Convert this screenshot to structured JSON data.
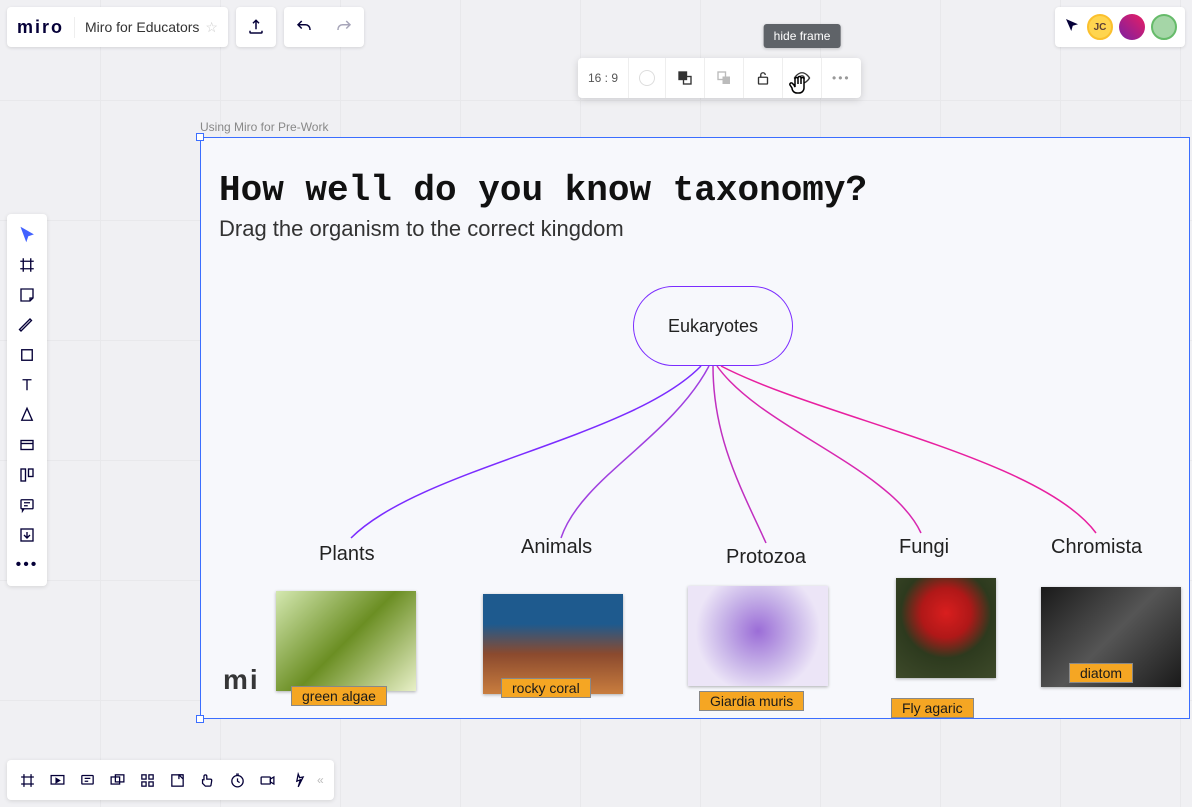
{
  "app": {
    "logo": "miro",
    "board_title": "Miro for Educators"
  },
  "ctx": {
    "ratio": "16 : 9",
    "tooltip": "hide frame"
  },
  "frame": {
    "label": "Using Miro for Pre-Work",
    "title": "How well do you know taxonomy?",
    "subtitle": "Drag the organism to the correct kingdom",
    "root": "Eukaryotes",
    "watermark": "mi",
    "kingdoms": [
      "Plants",
      "Animals",
      "Protozoa",
      "Fungi",
      "Chromista"
    ],
    "cards": [
      {
        "label": "green algae"
      },
      {
        "label": "rocky coral"
      },
      {
        "label": "Giardia muris"
      },
      {
        "label": "Fly agaric"
      },
      {
        "label": "diatom"
      }
    ]
  },
  "presence": {
    "initials": "JC"
  }
}
